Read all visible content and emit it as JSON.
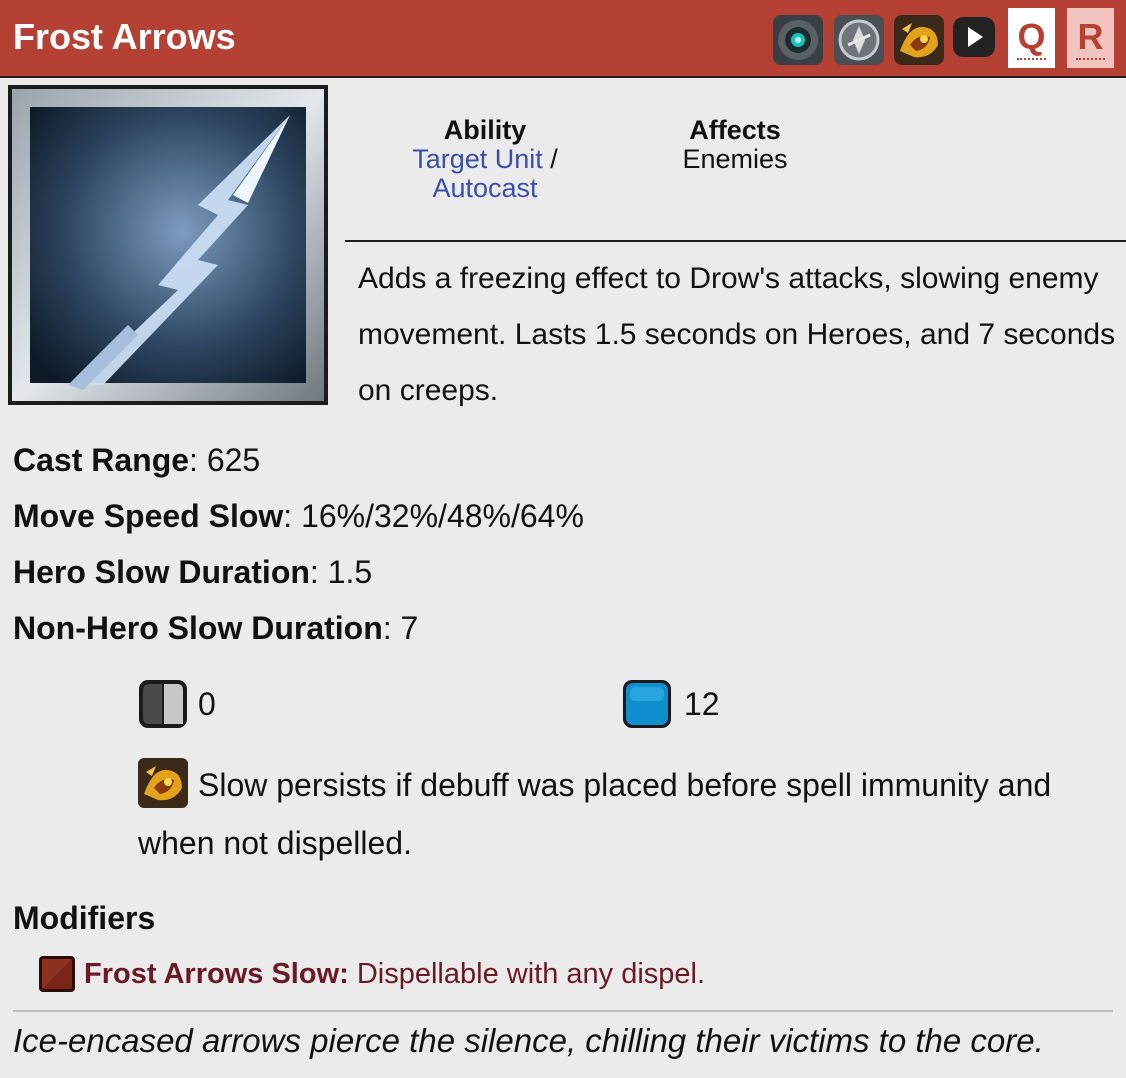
{
  "header": {
    "title": "Frost Arrows",
    "icons": [
      "aghanims-scepter-icon",
      "aghanims-shard-icon",
      "spell-immunity-icon",
      "play-icon"
    ],
    "keys": [
      "Q",
      "R"
    ],
    "bg_color": "#b54034"
  },
  "ability": {
    "ability_label": "Ability",
    "ability_value_1": "Target Unit",
    "ability_sep": " /",
    "ability_value_2": "Autocast",
    "affects_label": "Affects",
    "affects_value": "Enemies"
  },
  "description": "Adds a freezing effect to Drow's attacks, slowing enemy movement. Lasts 1.5 seconds on Heroes, and 7 seconds on creeps.",
  "stats": [
    {
      "label": "Cast Range",
      "value": ": 625"
    },
    {
      "label": "Move Speed Slow",
      "value": ": 16%/32%/48%/64%"
    },
    {
      "label": "Hero Slow Duration",
      "value": ": 1.5"
    },
    {
      "label": "Non-Hero Slow Duration",
      "value": ": 7"
    }
  ],
  "costs": {
    "cooldown_icon": "cooldown-icon",
    "cooldown": "0",
    "mana_icon": "mana-icon",
    "mana": "12"
  },
  "note": {
    "icon": "spell-immunity-icon",
    "text": "Slow persists if debuff was placed before spell immunity and when not dispelled."
  },
  "modifiers": {
    "heading": "Modifiers",
    "items": [
      {
        "name": "Frost Arrows Slow:",
        "desc": "Dispellable with any dispel.",
        "icon": "debuff-icon"
      }
    ]
  },
  "lore": "Ice-encased arrows pierce the silence, chilling their victims to the core."
}
